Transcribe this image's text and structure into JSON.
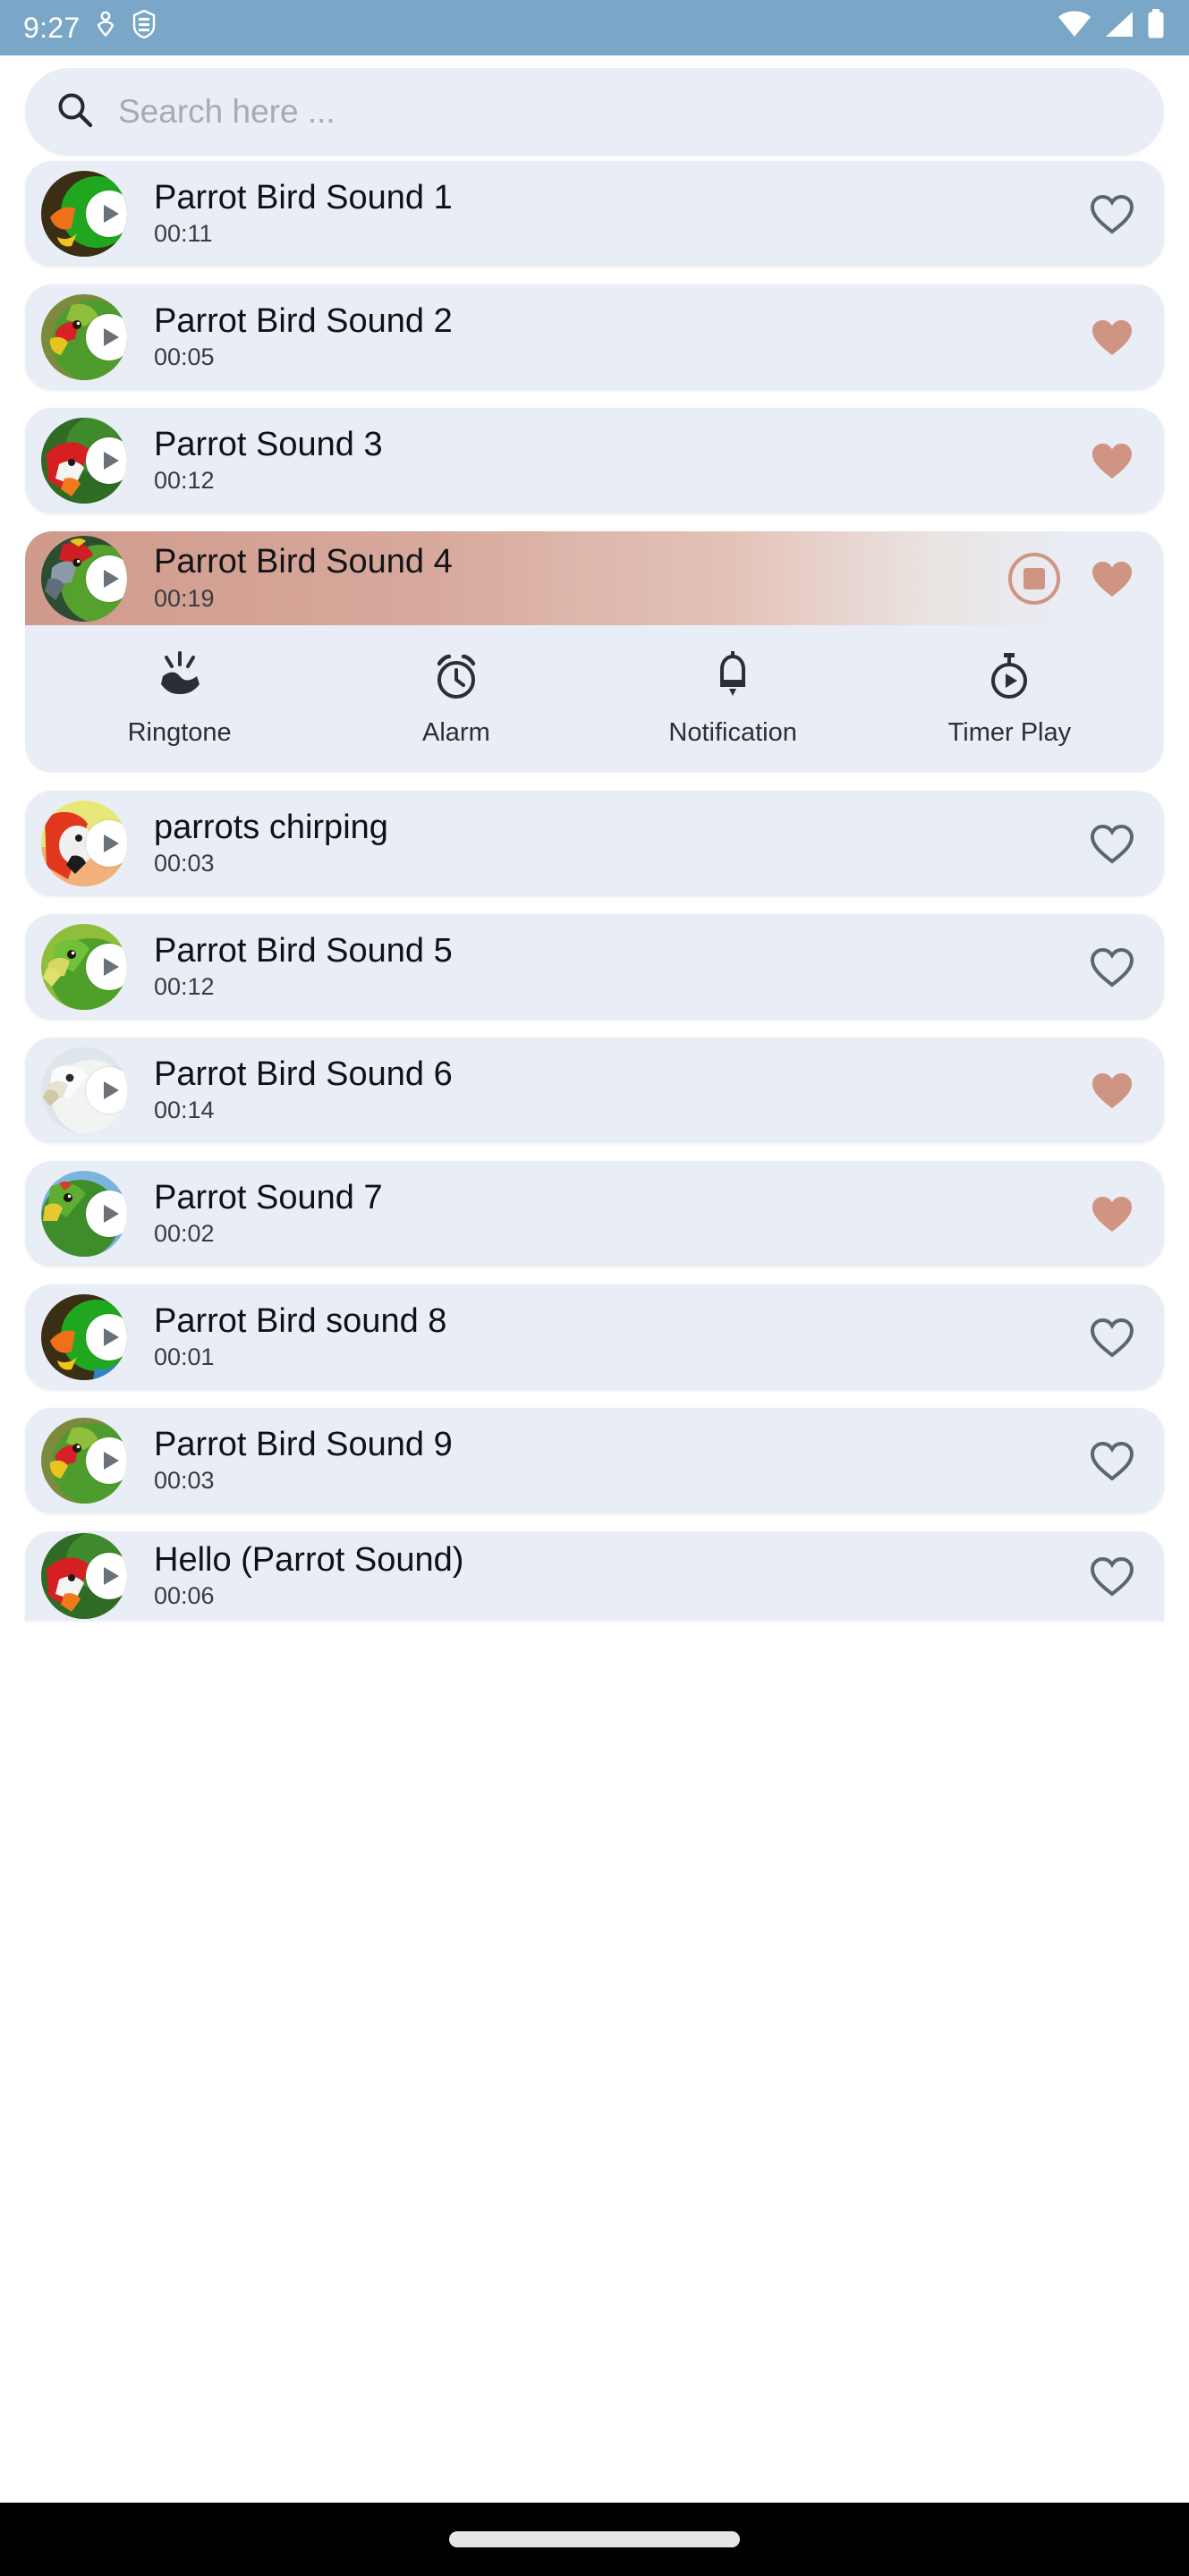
{
  "status_bar": {
    "time": "9:27",
    "left_icons": [
      "accessibility-icon",
      "vpn-key-icon"
    ],
    "right_icons": [
      "wifi-icon",
      "cellular-signal-icon",
      "battery-icon"
    ],
    "background_color": "#7aa7c7"
  },
  "search": {
    "placeholder": "Search here ...",
    "value": "",
    "icon": "search-icon"
  },
  "theme": {
    "card_background": "#e9edf6",
    "page_background": "#ffffff",
    "accent_salmon": "#cf9482",
    "heart_filled": "#cf9482",
    "heart_outline": "#5c666f"
  },
  "expanded_actions": [
    {
      "label": "Ringtone",
      "icon": "ringtone-icon"
    },
    {
      "label": "Alarm",
      "icon": "alarm-clock-icon"
    },
    {
      "label": "Notification",
      "icon": "notification-bell-icon"
    },
    {
      "label": "Timer Play",
      "icon": "timer-play-icon"
    }
  ],
  "sounds": [
    {
      "title": "Parrot Bird Sound 1",
      "duration": "00:11",
      "favorite": false,
      "playing": false,
      "art": "parrot-green-dark"
    },
    {
      "title": "Parrot Bird Sound 2",
      "duration": "00:05",
      "favorite": true,
      "playing": false,
      "art": "parrot-amazon-green"
    },
    {
      "title": "Parrot Sound 3",
      "duration": "00:12",
      "favorite": true,
      "playing": false,
      "art": "parrot-scarlet-macaw"
    },
    {
      "title": "Parrot Bird Sound 4",
      "duration": "00:19",
      "favorite": true,
      "playing": true,
      "art": "parrot-red-crowned",
      "progress_percent": 85
    },
    {
      "title": "parrots chirping",
      "duration": "00:03",
      "favorite": false,
      "playing": false,
      "art": "parrot-macaw-orange"
    },
    {
      "title": "Parrot Bird Sound 5",
      "duration": "00:12",
      "favorite": false,
      "playing": false,
      "art": "parrot-lime-green"
    },
    {
      "title": "Parrot Bird Sound 6",
      "duration": "00:14",
      "favorite": true,
      "playing": false,
      "art": "parrot-cockatoo-white"
    },
    {
      "title": "Parrot Sound 7",
      "duration": "00:02",
      "favorite": true,
      "playing": false,
      "art": "parrot-green-sky"
    },
    {
      "title": "Parrot Bird sound 8",
      "duration": "00:01",
      "favorite": false,
      "playing": false,
      "art": "parrot-green-dark"
    },
    {
      "title": "Parrot Bird Sound 9",
      "duration": "00:03",
      "favorite": false,
      "playing": false,
      "art": "parrot-amazon-green"
    },
    {
      "title": "Hello (Parrot Sound)",
      "duration": "00:06",
      "favorite": false,
      "playing": false,
      "art": "parrot-scarlet-macaw"
    }
  ]
}
